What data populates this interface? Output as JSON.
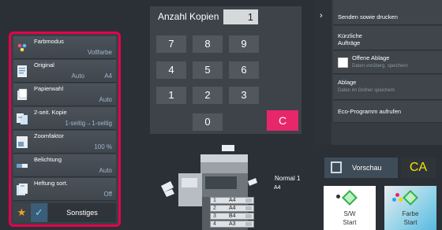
{
  "settings_panel": {
    "items": [
      {
        "label": "Farbmodus",
        "value": "Vollfarbe",
        "value2": "",
        "icon": "color-mode-icon"
      },
      {
        "label": "Original",
        "value": "A4",
        "value2": "Auto",
        "icon": "original-icon"
      },
      {
        "label": "Papierwahl",
        "value": "Auto",
        "value2": "",
        "icon": "paper-select-icon"
      },
      {
        "label": "2-seit. Kopie",
        "value": "1-seitig→1-seitig",
        "value2": "",
        "icon": "duplex-copy-icon"
      },
      {
        "label": "Zoomfaktor",
        "value": "100 %",
        "value2": "",
        "icon": "zoom-icon"
      },
      {
        "label": "Belichtung",
        "value": "Auto",
        "value2": "",
        "icon": "exposure-icon"
      },
      {
        "label": "Heftung sort.",
        "value": "Off",
        "value2": "",
        "icon": "staple-sort-icon"
      }
    ],
    "other_label": "Sonstiges"
  },
  "keypad": {
    "copies_label": "Anzahl Kopien",
    "copies_value": "1",
    "keys": [
      "7",
      "8",
      "9",
      "4",
      "5",
      "6",
      "1",
      "2",
      "3",
      "0"
    ],
    "clear_label": "C"
  },
  "right_menu": {
    "send_print": "Senden sowie drucken",
    "recent_jobs": "Kürzliche Aufträge",
    "open_storage_title": "Offene Ablage",
    "open_storage_sub": "Daten vorüberg. speichern",
    "storage_title": "Ablage",
    "storage_sub": "Daten im Ordner speichern",
    "eco": "Eco-Programm aufrufen"
  },
  "machine": {
    "output_label": "Normal 1",
    "output_paper": "A4",
    "trays": [
      {
        "num": "1",
        "paper": "A4"
      },
      {
        "num": "2",
        "paper": "A4"
      },
      {
        "num": "3",
        "paper": "B4"
      },
      {
        "num": "4",
        "paper": "A3"
      }
    ]
  },
  "buttons": {
    "preview": "Vorschau",
    "ca": "CA",
    "start_bw_line1": "S/W",
    "start_bw_line2": "Start",
    "start_color_line1": "Farbe",
    "start_color_line2": "Start"
  },
  "colors": {
    "highlight_border": "#e6004a",
    "clear_key": "#e8266a",
    "ca_text": "#f3e600",
    "start_diamond": "#2fb24c"
  }
}
